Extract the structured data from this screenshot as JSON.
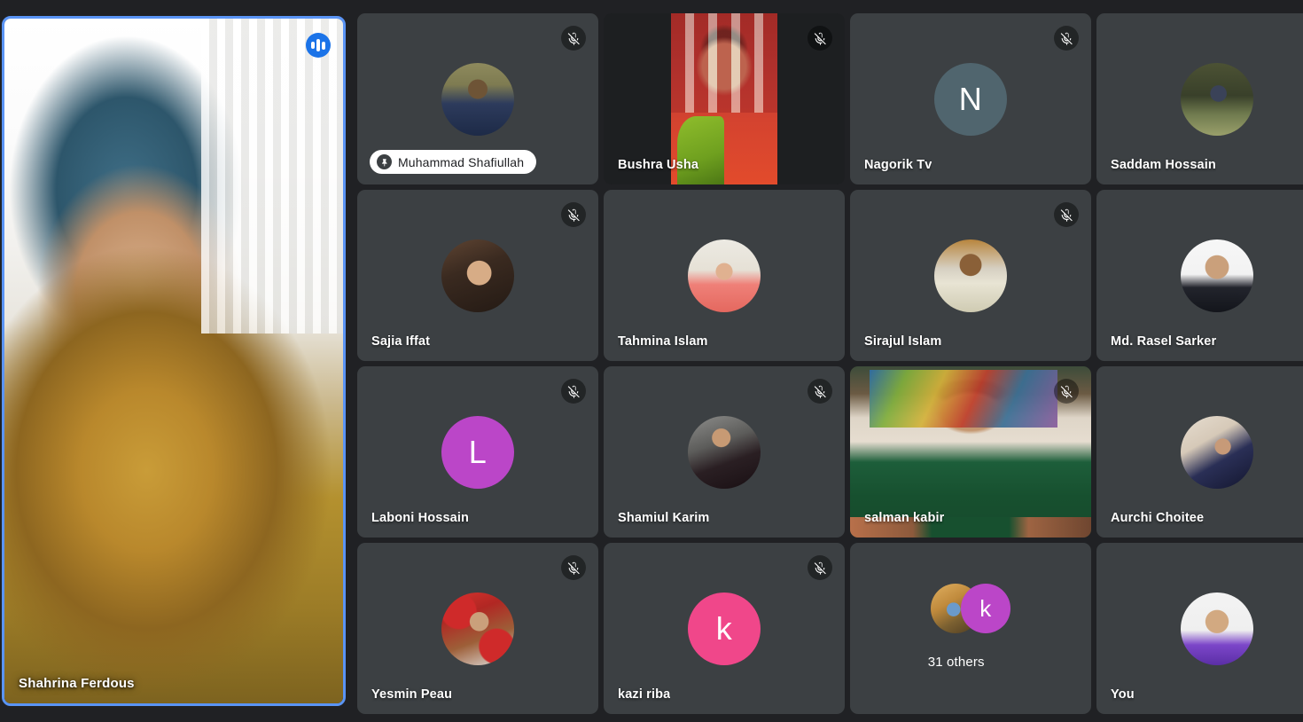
{
  "meeting": {
    "page_background": "#202124",
    "tile_background": "#3c4043",
    "active_border_color": "#5a94f5",
    "accent_blue": "#1b73e8"
  },
  "main_speaker": {
    "name": "Shahrina Ferdous",
    "audio_indicator_icon": "audio-level-icon",
    "is_active_speaker": true
  },
  "grid": {
    "participants": [
      {
        "name": "Muhammad Shafiullah",
        "muted": true,
        "label_style": "pill",
        "badge_icon": "pin-icon",
        "avatar": "photo",
        "avatar_class": "ph-shafiullah",
        "initial": ""
      },
      {
        "name": "Bushra Usha",
        "muted": true,
        "label_style": "plain",
        "avatar": "video",
        "video_class": "vid-bushra",
        "initial": ""
      },
      {
        "name": "Nagorik Tv",
        "muted": true,
        "label_style": "plain",
        "avatar": "initial",
        "initial": "N",
        "avatar_color": "#50656e"
      },
      {
        "name": "Saddam Hossain",
        "muted": false,
        "label_style": "plain",
        "avatar": "photo",
        "avatar_class": "ph-saddam",
        "initial": ""
      },
      {
        "name": "Sajia Iffat",
        "muted": true,
        "label_style": "plain",
        "avatar": "photo",
        "avatar_class": "ph-sajia",
        "initial": ""
      },
      {
        "name": "Tahmina Islam",
        "muted": false,
        "label_style": "plain",
        "avatar": "photo",
        "avatar_class": "ph-tahmina",
        "initial": ""
      },
      {
        "name": "Sirajul Islam",
        "muted": true,
        "label_style": "plain",
        "avatar": "photo",
        "avatar_class": "ph-sirajul",
        "initial": ""
      },
      {
        "name": "Md. Rasel Sarker",
        "muted": false,
        "label_style": "plain",
        "avatar": "photo",
        "avatar_class": "ph-rasel",
        "initial": ""
      },
      {
        "name": "Laboni Hossain",
        "muted": true,
        "label_style": "plain",
        "avatar": "initial",
        "initial": "L",
        "avatar_color": "#bb46c8"
      },
      {
        "name": "Shamiul Karim",
        "muted": true,
        "label_style": "plain",
        "avatar": "photo",
        "avatar_class": "ph-shamiul",
        "initial": ""
      },
      {
        "name": "salman kabir",
        "muted": true,
        "label_style": "plain",
        "avatar": "video",
        "video_class": "vid-salman",
        "initial": ""
      },
      {
        "name": "Aurchi Choitee",
        "muted": false,
        "label_style": "plain",
        "avatar": "photo",
        "avatar_class": "ph-aurchi",
        "initial": ""
      },
      {
        "name": "Yesmin Peau",
        "muted": true,
        "label_style": "plain",
        "avatar": "photo",
        "avatar_class": "ph-yesmin",
        "initial": ""
      },
      {
        "name": "kazi riba",
        "muted": true,
        "label_style": "plain",
        "avatar": "initial",
        "initial": "k",
        "avatar_color": "#f0478a"
      },
      {
        "name": "31 others",
        "muted": false,
        "label_style": "centered",
        "avatar": "stack",
        "initial": "k",
        "avatar_color": "#bb46c8",
        "avatar_class": "ph-others"
      },
      {
        "name": "You",
        "muted": false,
        "label_style": "plain",
        "avatar": "photo",
        "avatar_class": "ph-you",
        "initial": ""
      }
    ]
  },
  "icons": {
    "mute": "mic-off-icon",
    "audio_level": "audio-level-icon",
    "pin": "pin-icon"
  }
}
